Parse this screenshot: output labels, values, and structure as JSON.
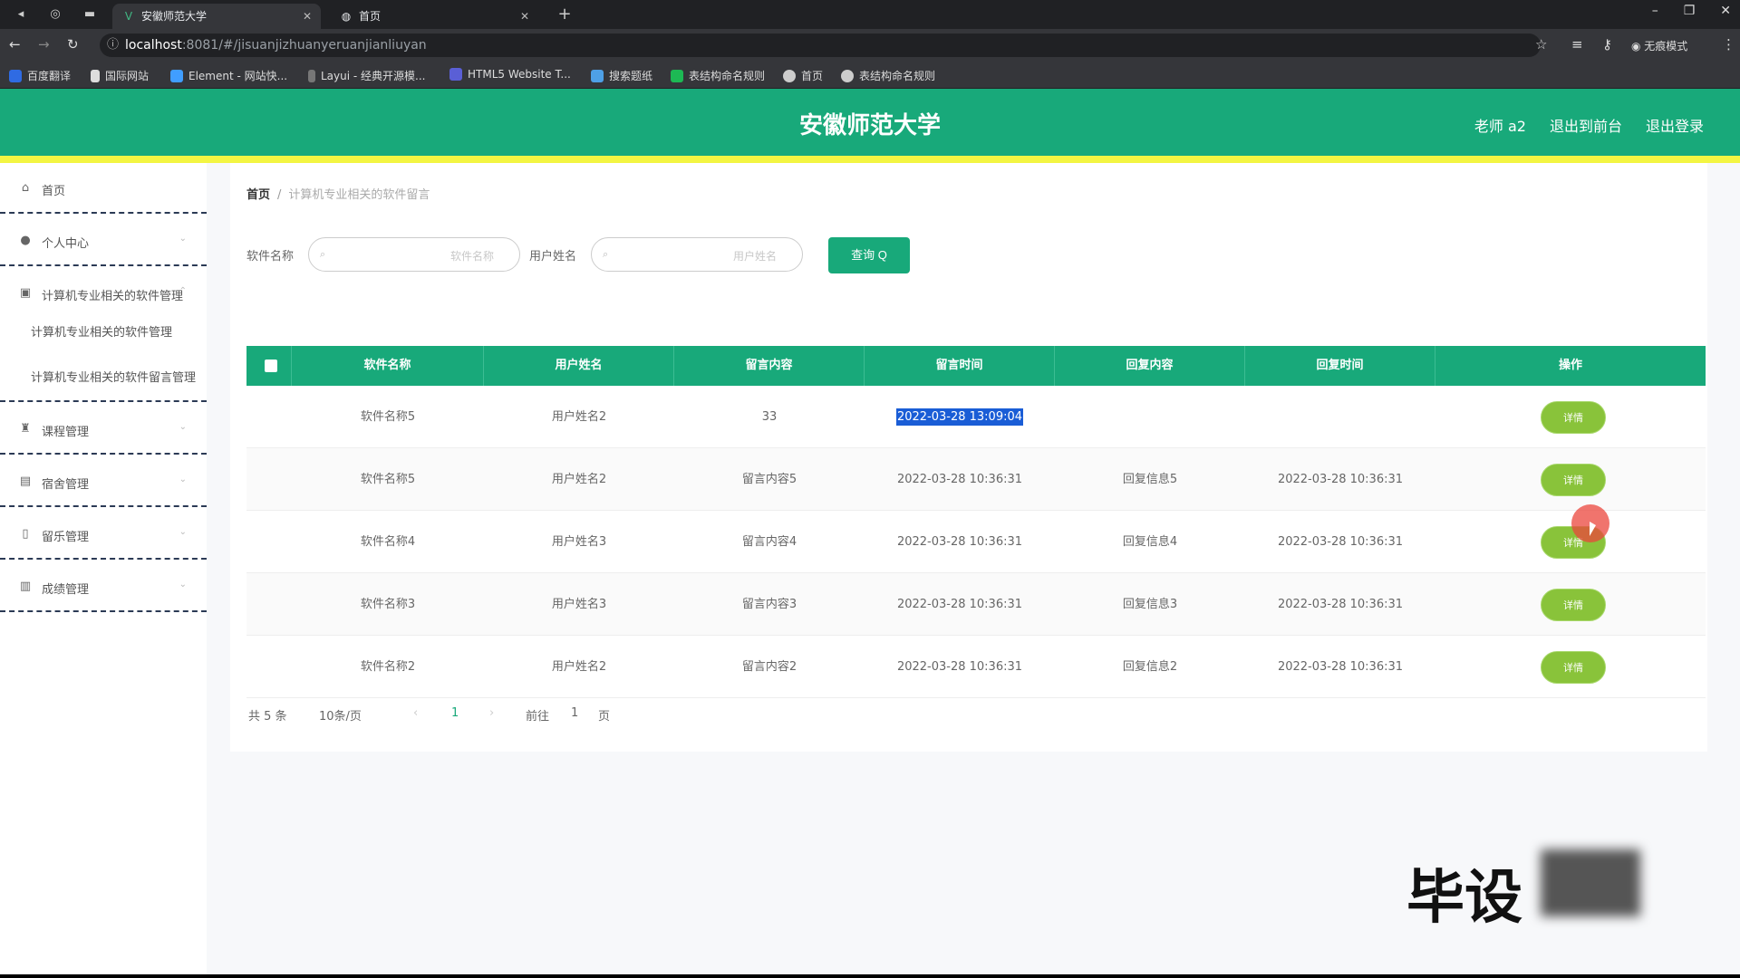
{
  "browser": {
    "tabs": [
      {
        "title": "安徽师范大学",
        "icon": "vue-logo-icon"
      },
      {
        "title": "首页",
        "icon": "globe-icon"
      }
    ],
    "new_tab": "+",
    "url_host": "localhost",
    "url_rest": ":8081/#/jisuanjizhuanyeruanjianliuyan",
    "profile": "无痕模式",
    "bookmarks": [
      "百度翻译",
      "国际网站",
      "Element - 网站快...",
      "Layui - 经典开源模...",
      "HTML5 Website T...",
      "搜索题纸",
      "表结构命名规则",
      "首页",
      "表结构命名规则"
    ]
  },
  "header": {
    "title": "安徽师范大学",
    "user": "老师 a2",
    "exit_front": "退出到前台",
    "logout": "退出登录"
  },
  "sidebar": {
    "items": [
      {
        "label": "首页",
        "icon": "home-icon"
      },
      {
        "label": "个人中心",
        "icon": "user-icon"
      },
      {
        "label": "计算机专业相关的软件管理",
        "icon": "briefcase-icon"
      },
      {
        "label": "课程管理",
        "icon": "trophy-icon"
      },
      {
        "label": "宿舍管理",
        "icon": "building-icon"
      },
      {
        "label": "留乐管理",
        "icon": "phone-icon"
      },
      {
        "label": "成绩管理",
        "icon": "chart-icon"
      }
    ],
    "subitems": [
      "计算机专业相关的软件管理",
      "计算机专业相关的软件留言管理"
    ]
  },
  "breadcrumb": {
    "home": "首页",
    "sep": "/",
    "current": "计算机专业相关的软件留言"
  },
  "search": {
    "software_label": "软件名称",
    "software_placeholder": "软件名称",
    "user_label": "用户姓名",
    "user_placeholder": "用户姓名",
    "button": "查询 Q"
  },
  "table": {
    "headers": [
      "软件名称",
      "用户姓名",
      "留言内容",
      "留言时间",
      "回复内容",
      "回复时间",
      "操作"
    ],
    "rows": [
      {
        "software": "软件名称5",
        "user": "用户姓名2",
        "content": "33",
        "time": "2022-03-28 13:09:04",
        "reply": "",
        "reply_time": "",
        "op": "详情"
      },
      {
        "software": "软件名称5",
        "user": "用户姓名2",
        "content": "留言内容5",
        "time": "2022-03-28 10:36:31",
        "reply": "回复信息5",
        "reply_time": "2022-03-28 10:36:31",
        "op": "详情"
      },
      {
        "software": "软件名称4",
        "user": "用户姓名3",
        "content": "留言内容4",
        "time": "2022-03-28 10:36:31",
        "reply": "回复信息4",
        "reply_time": "2022-03-28 10:36:31",
        "op": "详情"
      },
      {
        "software": "软件名称3",
        "user": "用户姓名3",
        "content": "留言内容3",
        "time": "2022-03-28 10:36:31",
        "reply": "回复信息3",
        "reply_time": "2022-03-28 10:36:31",
        "op": "详情"
      },
      {
        "software": "软件名称2",
        "user": "用户姓名2",
        "content": "留言内容2",
        "time": "2022-03-28 10:36:31",
        "reply": "回复信息2",
        "reply_time": "2022-03-28 10:36:31",
        "op": "详情"
      }
    ]
  },
  "pagination": {
    "total": "共 5 条",
    "page_size": "10条/页",
    "prev": "‹",
    "current": "1",
    "next": "›",
    "goto": "前往",
    "goto_value": "1",
    "page_unit": "页"
  },
  "watermark": "毕设"
}
